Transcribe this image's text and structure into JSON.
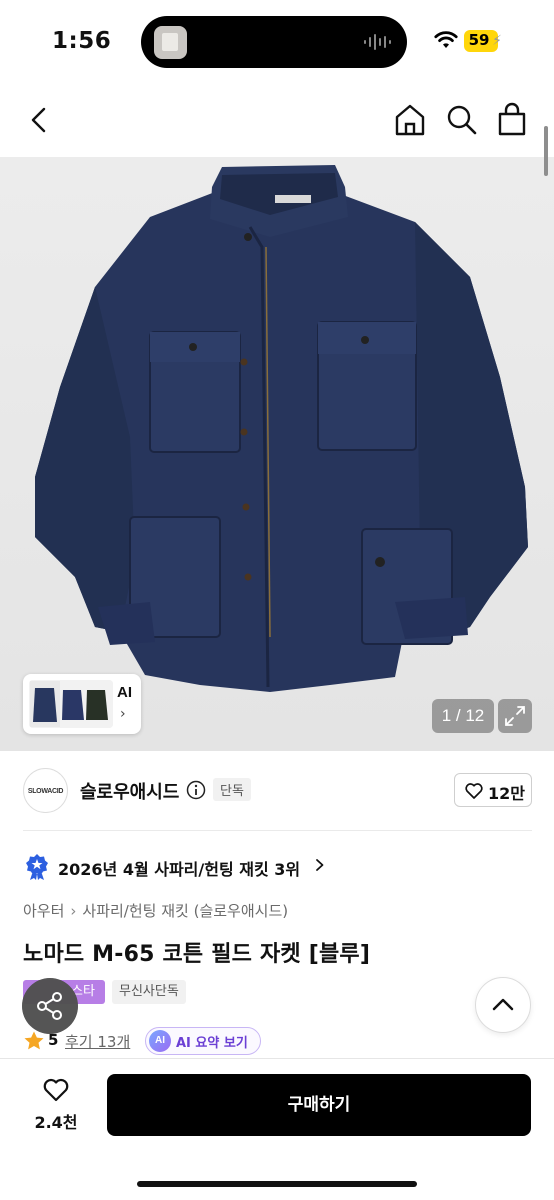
{
  "status_bar": {
    "time": "1:56",
    "battery": "59"
  },
  "nav": {
    "back": "chevron-left-icon",
    "home": "home-icon",
    "search": "search-icon",
    "bag": "shopping-bag-icon"
  },
  "gallery": {
    "ai_label": "AI",
    "counter": "1 / 12",
    "colors": {
      "jacket": "#26345a",
      "background": "#e8e8e8"
    }
  },
  "brand": {
    "logo_text": "SLOWACID",
    "name": "슬로우애시드",
    "badge": "단독",
    "likes": "12만"
  },
  "ranking": {
    "text": "2026년 4월 사파리/헌팅 재킷 3위"
  },
  "breadcrumb": {
    "level1": "아우터",
    "level2": "사파리/헌팅 재킷 (슬로우애시드)"
  },
  "product": {
    "title": "노마드 M-65 코튼 필드 자켓 [블루]"
  },
  "tags": {
    "purple": "스타",
    "gray": "무신사단독"
  },
  "rating": {
    "score": "5",
    "reviews": "후기 13개",
    "ai_summary": "AI 요약 보기",
    "ai_logo": "AI"
  },
  "bottom": {
    "wish_count": "2.4천",
    "buy_label": "구매하기"
  }
}
